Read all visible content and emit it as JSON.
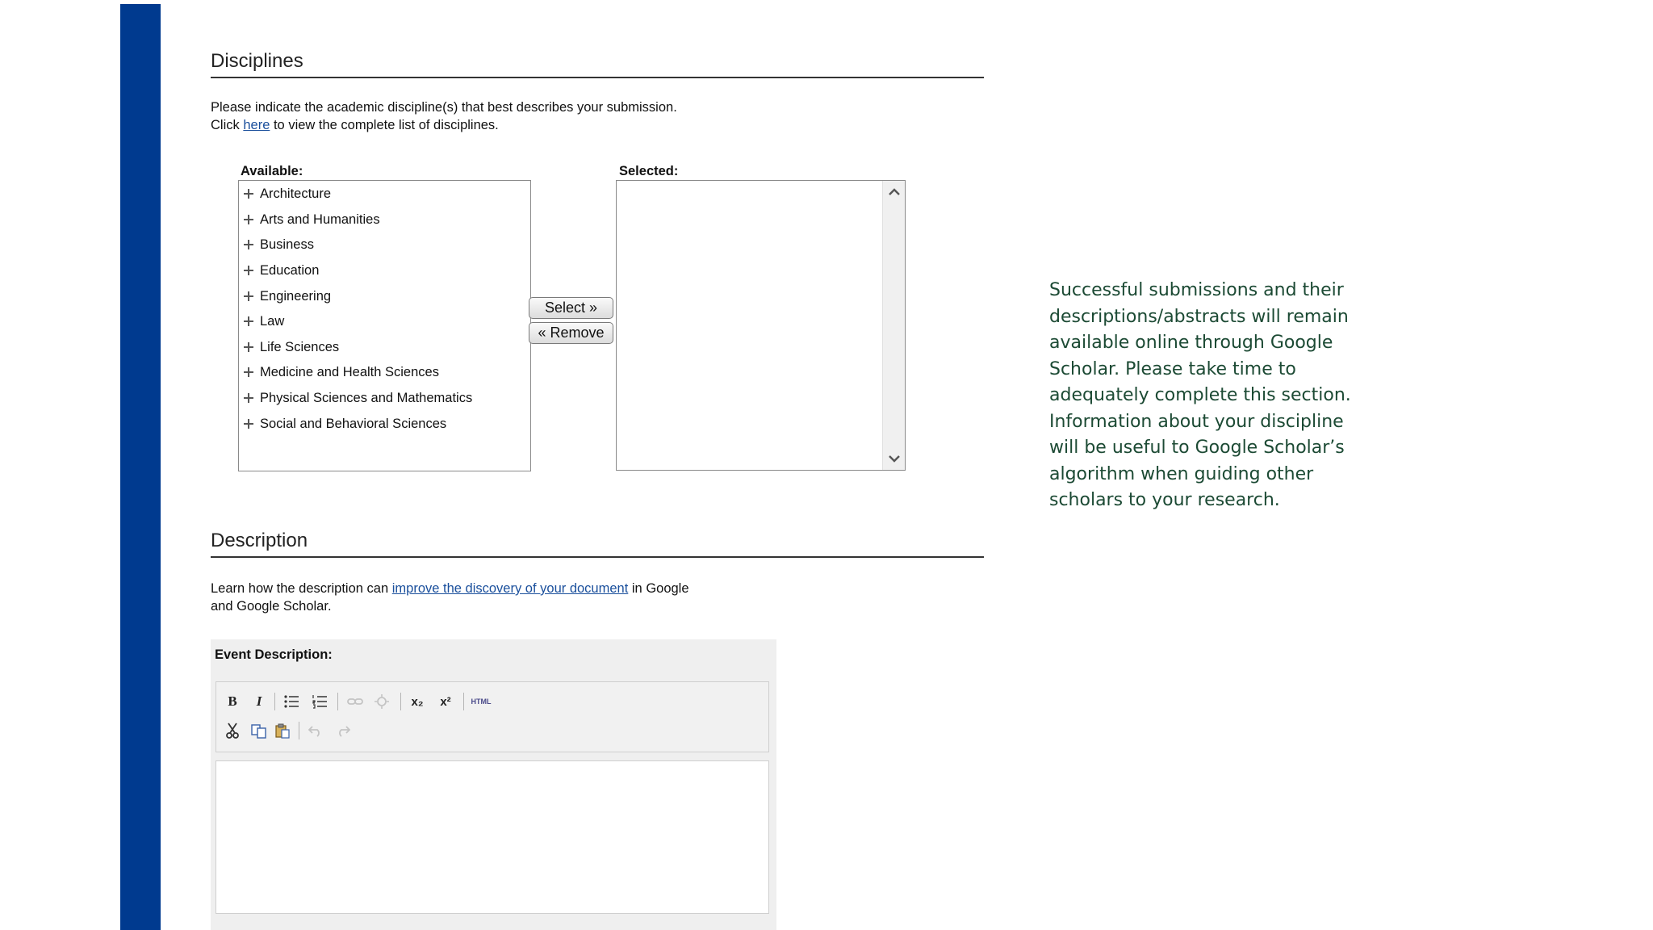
{
  "disciplines": {
    "title": "Disciplines",
    "instruction_line1": "Please indicate the academic discipline(s) that best describes your submission.",
    "instruction_click": "Click",
    "instruction_link": "here",
    "instruction_rest": "to view the complete list of disciplines.",
    "available_label": "Available:",
    "selected_label": "Selected:",
    "available_items": [
      "Architecture",
      "Arts and Humanities",
      "Business",
      "Education",
      "Engineering",
      "Law",
      "Life Sciences",
      "Medicine and Health Sciences",
      "Physical Sciences and Mathematics",
      "Social and Behavioral Sciences"
    ],
    "select_button": "Select »",
    "remove_button": "« Remove"
  },
  "description": {
    "title": "Description",
    "learn_prefix": "Learn how the description can",
    "learn_link": "improve the discovery of your document",
    "learn_suffix": "in Google",
    "learn_line2": "and Google Scholar.",
    "event_label": "Event Description:",
    "toolbar": {
      "bold": "B",
      "italic": "I",
      "subscript": "x₂",
      "superscript": "x²",
      "html": "HTML"
    }
  },
  "side_note": "Successful submissions and their descriptions/abstracts will remain available online through Google Scholar. Please take time to adequately complete this section. Information about your discipline will be useful to Google Scholar’s algorithm when guiding other scholars to your research.",
  "colors": {
    "accent_bar": "#003a8f",
    "link": "#1a4f9c",
    "note_text": "#1c4a34"
  }
}
